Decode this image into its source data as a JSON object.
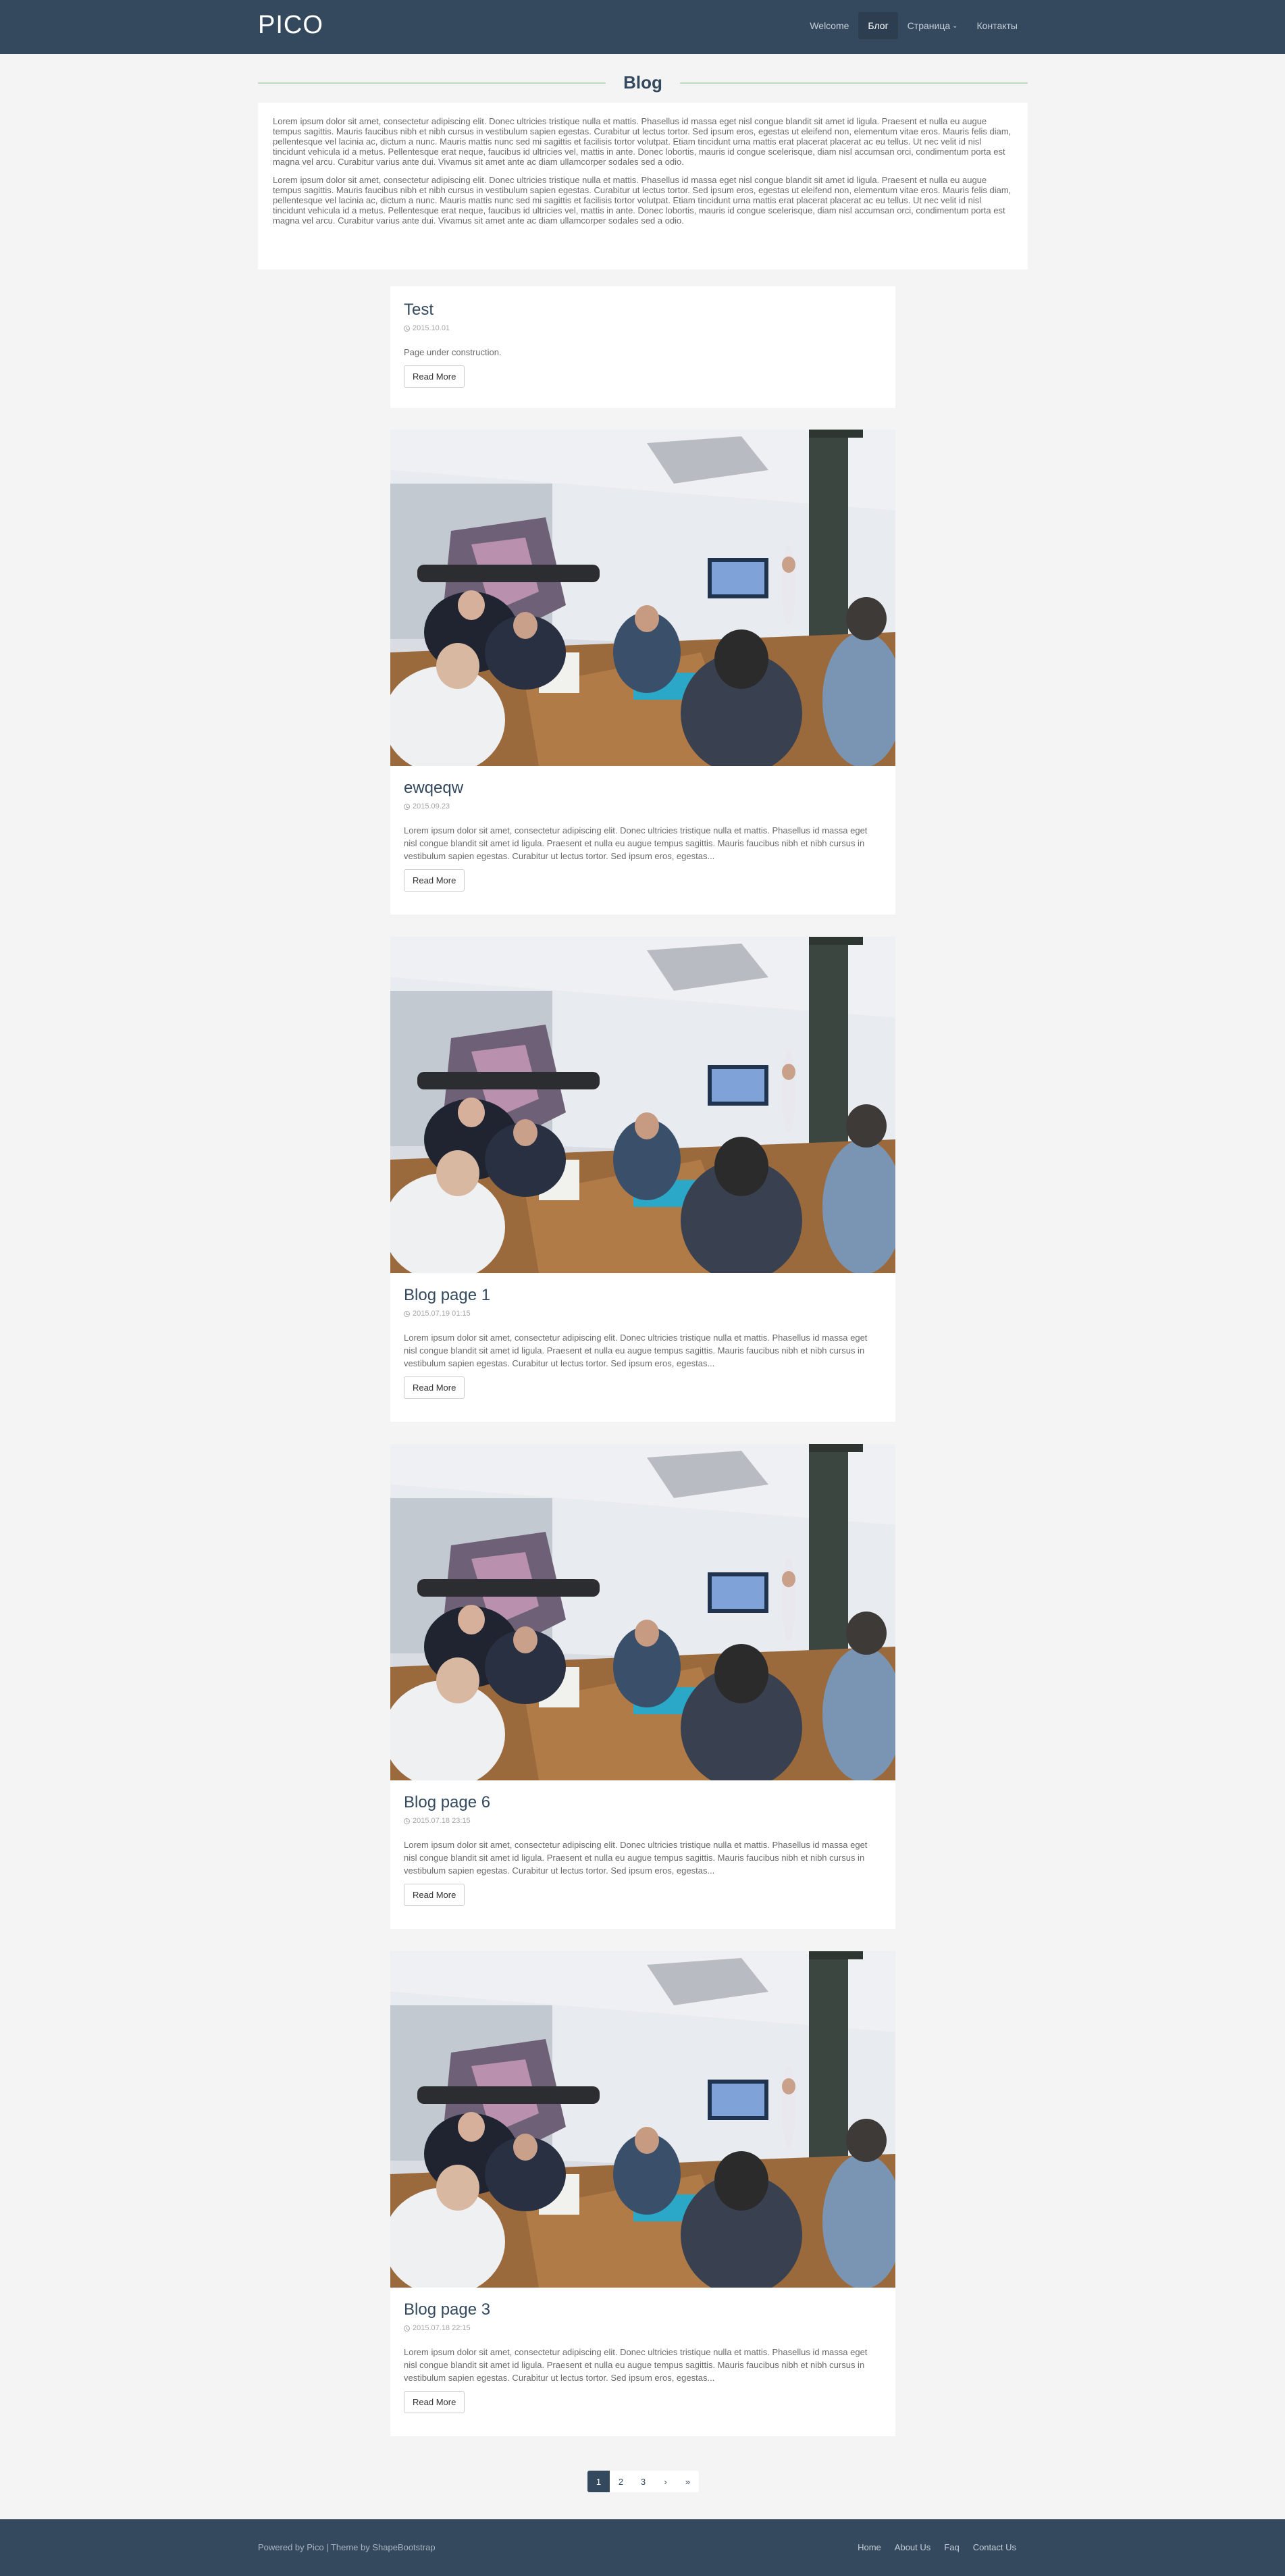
{
  "navbar": {
    "logo": "PICO",
    "items": [
      {
        "label": "Welcome"
      },
      {
        "label": "Блог"
      },
      {
        "label": "Страница"
      },
      {
        "label": "Контакты"
      }
    ],
    "active_index": 1
  },
  "section": {
    "title": "Blog"
  },
  "intro": {
    "paragraphs": [
      "Lorem ipsum dolor sit amet, consectetur adipiscing elit. Donec ultricies tristique nulla et mattis. Phasellus id massa eget nisl congue blandit sit amet id ligula. Praesent et nulla eu augue tempus sagittis. Mauris faucibus nibh et nibh cursus in vestibulum sapien egestas. Curabitur ut lectus tortor. Sed ipsum eros, egestas ut eleifend non, elementum vitae eros. Mauris felis diam, pellentesque vel lacinia ac, dictum a nunc. Mauris mattis nunc sed mi sagittis et facilisis tortor volutpat. Etiam tincidunt urna mattis erat placerat placerat ac eu tellus. Ut nec velit id nisl tincidunt vehicula id a metus. Pellentesque erat neque, faucibus id ultricies vel, mattis in ante. Donec lobortis, mauris id congue scelerisque, diam nisl accumsan orci, condimentum porta est magna vel arcu. Curabitur varius ante dui. Vivamus sit amet ante ac diam ullamcorper sodales sed a odio.",
      "Lorem ipsum dolor sit amet, consectetur adipiscing elit. Donec ultricies tristique nulla et mattis. Phasellus id massa eget nisl congue blandit sit amet id ligula. Praesent et nulla eu augue tempus sagittis. Mauris faucibus nibh et nibh cursus in vestibulum sapien egestas. Curabitur ut lectus tortor. Sed ipsum eros, egestas ut eleifend non, elementum vitae eros. Mauris felis diam, pellentesque vel lacinia ac, dictum a nunc. Mauris mattis nunc sed mi sagittis et facilisis tortor volutpat. Etiam tincidunt urna mattis erat placerat placerat ac eu tellus. Ut nec velit id nisl tincidunt vehicula id a metus. Pellentesque erat neque, faucibus id ultricies vel, mattis in ante. Donec lobortis, mauris id congue scelerisque, diam nisl accumsan orci, condimentum porta est magna vel arcu. Curabitur varius ante dui. Vivamus sit amet ante ac diam ullamcorper sodales sed a odio."
    ]
  },
  "posts": [
    {
      "title": "Test",
      "date": "2015.10.01",
      "excerpt": "Page under construction.",
      "button": "Read More"
    },
    {
      "title": "ewqeqw",
      "date": "2015.09.23",
      "excerpt": "Lorem ipsum dolor sit amet, consectetur adipiscing elit. Donec ultricies tristique nulla et mattis. Phasellus id massa eget nisl congue blandit sit amet id ligula. Praesent et nulla eu augue tempus sagittis. Mauris faucibus nibh et nibh cursus in vestibulum sapien egestas. Curabitur ut lectus tortor. Sed ipsum eros, egestas...",
      "button": "Read More"
    },
    {
      "title": "Blog page 1",
      "date": "2015.07.19 01:15",
      "excerpt": "Lorem ipsum dolor sit amet, consectetur adipiscing elit. Donec ultricies tristique nulla et mattis. Phasellus id massa eget nisl congue blandit sit amet id ligula. Praesent et nulla eu augue tempus sagittis. Mauris faucibus nibh et nibh cursus in vestibulum sapien egestas. Curabitur ut lectus tortor. Sed ipsum eros, egestas...",
      "button": "Read More"
    },
    {
      "title": "Blog page 6",
      "date": "2015.07.18 23:15",
      "excerpt": "Lorem ipsum dolor sit amet, consectetur adipiscing elit. Donec ultricies tristique nulla et mattis. Phasellus id massa eget nisl congue blandit sit amet id ligula. Praesent et nulla eu augue tempus sagittis. Mauris faucibus nibh et nibh cursus in vestibulum sapien egestas. Curabitur ut lectus tortor. Sed ipsum eros, egestas...",
      "button": "Read More"
    },
    {
      "title": "Blog page 3",
      "date": "2015.07.18 22:15",
      "excerpt": "Lorem ipsum dolor sit amet, consectetur adipiscing elit. Donec ultricies tristique nulla et mattis. Phasellus id massa eget nisl congue blandit sit amet id ligula. Praesent et nulla eu augue tempus sagittis. Mauris faucibus nibh et nibh cursus in vestibulum sapien egestas. Curabitur ut lectus tortor. Sed ipsum eros, egestas...",
      "button": "Read More"
    }
  ],
  "pagination": {
    "pages": [
      "1",
      "2",
      "3",
      "›",
      "»"
    ],
    "current": "1"
  },
  "footer": {
    "credit": "Powered by Pico | Theme by ShapeBootstrap",
    "links": [
      "Home",
      "About Us",
      "Faq",
      "Contact Us"
    ]
  },
  "colors": {
    "navbar_bg": "#34495e",
    "page_bg": "#f4f4f4",
    "heading": "#34495e",
    "title_rule": "#b9dfb9"
  }
}
